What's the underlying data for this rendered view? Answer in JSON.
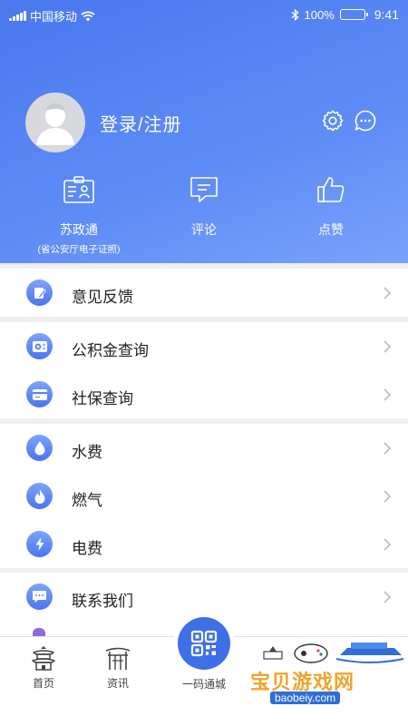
{
  "status_bar": {
    "carrier": "中国移动",
    "battery": "100%",
    "time": "9:41"
  },
  "profile": {
    "login_label": "登录/注册"
  },
  "quick_actions": [
    {
      "label": "苏政通",
      "sub": "(省公安厅电子证照)",
      "icon": "id-card-icon"
    },
    {
      "label": "评论",
      "icon": "comment-icon"
    },
    {
      "label": "点赞",
      "icon": "thumbs-up-icon"
    }
  ],
  "menu": {
    "feedback": "意见反馈",
    "fund": "公积金查询",
    "social": "社保查询",
    "water": "水费",
    "gas": "燃气",
    "electric": "电费",
    "contact": "联系我们"
  },
  "tabbar": {
    "home": "首页",
    "news": "资讯",
    "code": "一码通城"
  },
  "watermark": {
    "title": "宝贝游戏网",
    "url": "baobeiy.com"
  },
  "colors": {
    "primary": "#4a78ee",
    "icon_gradient_top": "#7ea4fb",
    "page_bg": "#eeeff3"
  }
}
